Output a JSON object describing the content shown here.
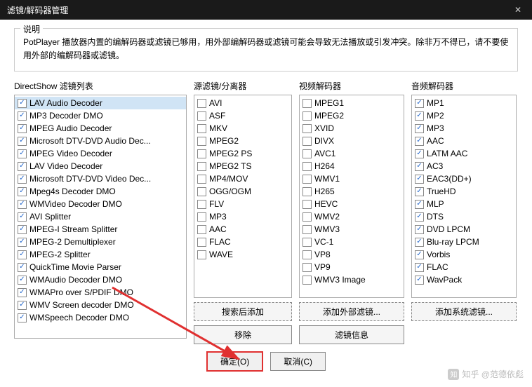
{
  "window": {
    "title": "滤镜/解码器管理"
  },
  "desc": {
    "legend": "说明",
    "text": "PotPlayer 播放器内置的编解码器或滤镜已够用，用外部编解码器或滤镜可能会导致无法播放或引发冲突。除非万不得已，请不要使用外部的编解码器或滤镜。"
  },
  "cols": {
    "directshow": {
      "label": "DirectShow 滤镜列表",
      "items": [
        {
          "c": 1,
          "t": "LAV Audio Decoder",
          "sel": 1
        },
        {
          "c": 1,
          "t": "MP3 Decoder DMO"
        },
        {
          "c": 1,
          "t": "MPEG Audio Decoder"
        },
        {
          "c": 1,
          "t": "Microsoft DTV-DVD Audio Dec..."
        },
        {
          "c": 1,
          "t": "MPEG Video Decoder"
        },
        {
          "c": 1,
          "t": "LAV Video Decoder"
        },
        {
          "c": 1,
          "t": "Microsoft DTV-DVD Video Dec..."
        },
        {
          "c": 1,
          "t": "Mpeg4s Decoder DMO"
        },
        {
          "c": 1,
          "t": "WMVideo Decoder DMO"
        },
        {
          "c": 1,
          "t": "AVI Splitter"
        },
        {
          "c": 1,
          "t": "MPEG-I Stream Splitter"
        },
        {
          "c": 1,
          "t": "MPEG-2 Demultiplexer"
        },
        {
          "c": 1,
          "t": "MPEG-2 Splitter"
        },
        {
          "c": 1,
          "t": "QuickTime Movie Parser"
        },
        {
          "c": 1,
          "t": "WMAudio Decoder DMO"
        },
        {
          "c": 1,
          "t": "WMAPro over S/PDIF DMO"
        },
        {
          "c": 1,
          "t": "WMV Screen decoder DMO"
        },
        {
          "c": 1,
          "t": "WMSpeech Decoder DMO"
        }
      ]
    },
    "source": {
      "label": "源滤镜/分离器",
      "items": [
        {
          "c": 0,
          "t": "AVI"
        },
        {
          "c": 0,
          "t": "ASF"
        },
        {
          "c": 0,
          "t": "MKV"
        },
        {
          "c": 0,
          "t": "MPEG2"
        },
        {
          "c": 0,
          "t": "MPEG2 PS"
        },
        {
          "c": 0,
          "t": "MPEG2 TS"
        },
        {
          "c": 0,
          "t": "MP4/MOV"
        },
        {
          "c": 0,
          "t": "OGG/OGM"
        },
        {
          "c": 0,
          "t": "FLV"
        },
        {
          "c": 0,
          "t": "MP3"
        },
        {
          "c": 0,
          "t": "AAC"
        },
        {
          "c": 0,
          "t": "FLAC"
        },
        {
          "c": 0,
          "t": "WAVE"
        }
      ]
    },
    "video": {
      "label": "视频解码器",
      "items": [
        {
          "c": 0,
          "t": "MPEG1"
        },
        {
          "c": 0,
          "t": "MPEG2"
        },
        {
          "c": 0,
          "t": "XVID"
        },
        {
          "c": 0,
          "t": "DIVX"
        },
        {
          "c": 0,
          "t": "AVC1"
        },
        {
          "c": 0,
          "t": "H264"
        },
        {
          "c": 0,
          "t": "WMV1"
        },
        {
          "c": 0,
          "t": "H265"
        },
        {
          "c": 0,
          "t": "HEVC"
        },
        {
          "c": 0,
          "t": "WMV2"
        },
        {
          "c": 0,
          "t": "WMV3"
        },
        {
          "c": 0,
          "t": "VC-1"
        },
        {
          "c": 0,
          "t": "VP8"
        },
        {
          "c": 0,
          "t": "VP9"
        },
        {
          "c": 0,
          "t": "WMV3 Image"
        }
      ]
    },
    "audio": {
      "label": "音频解码器",
      "items": [
        {
          "c": 1,
          "t": "MP1"
        },
        {
          "c": 1,
          "t": "MP2"
        },
        {
          "c": 1,
          "t": "MP3"
        },
        {
          "c": 1,
          "t": "AAC"
        },
        {
          "c": 1,
          "t": "LATM AAC"
        },
        {
          "c": 1,
          "t": "AC3"
        },
        {
          "c": 1,
          "t": "EAC3(DD+)"
        },
        {
          "c": 1,
          "t": "TrueHD"
        },
        {
          "c": 1,
          "t": "MLP"
        },
        {
          "c": 1,
          "t": "DTS"
        },
        {
          "c": 1,
          "t": "DVD LPCM"
        },
        {
          "c": 1,
          "t": "Blu-ray LPCM"
        },
        {
          "c": 1,
          "t": "Vorbis"
        },
        {
          "c": 1,
          "t": "FLAC"
        },
        {
          "c": 1,
          "t": "WavPack"
        }
      ]
    }
  },
  "buttons": {
    "search_add": "搜索后添加",
    "remove": "移除",
    "add_external": "添加外部滤镜...",
    "filter_info": "滤镜信息",
    "add_system": "添加系统滤镜...",
    "ok": "确定(O)",
    "cancel": "取消(C)"
  },
  "watermark": "知乎 @范德依彪"
}
